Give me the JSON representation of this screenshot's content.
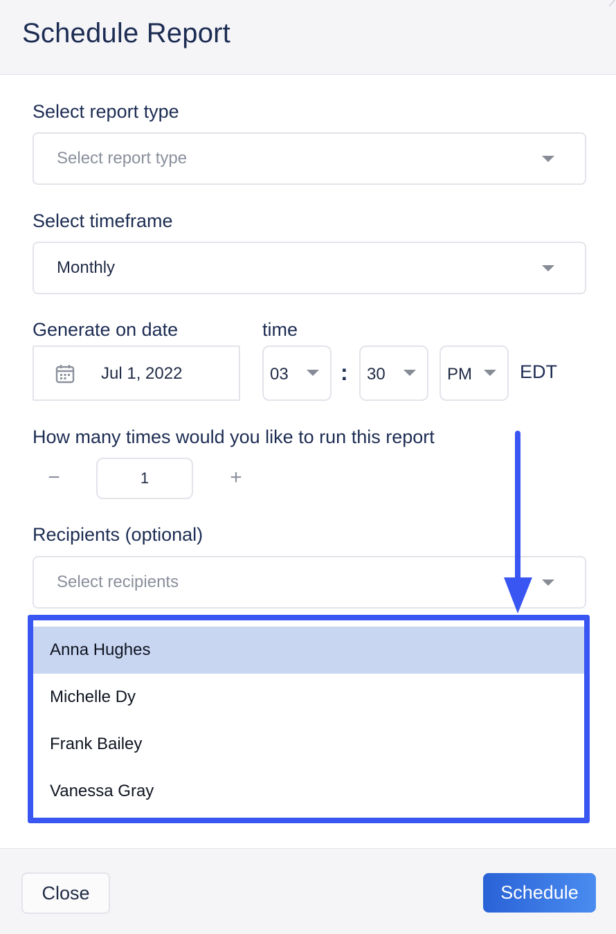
{
  "dialog": {
    "title": "Schedule Report"
  },
  "report_type": {
    "label": "Select report type",
    "placeholder": "Select report type"
  },
  "timeframe": {
    "label": "Select timeframe",
    "value": "Monthly"
  },
  "generate": {
    "date_label": "Generate on date",
    "date_value": "Jul 1, 2022",
    "time_label": "time",
    "hour": "03",
    "separator": ":",
    "minute": "30",
    "ampm": "PM",
    "timezone": "EDT"
  },
  "run_count": {
    "label": "How many times would you like to run this report",
    "minus": "−",
    "value": "1",
    "plus": "+"
  },
  "recipients": {
    "label": "Recipients (optional)",
    "placeholder": "Select recipients",
    "options": [
      "Anna Hughes",
      "Michelle Dy",
      "Frank Bailey",
      "Vanessa Gray"
    ]
  },
  "footer": {
    "close_label": "Close",
    "schedule_label": "Schedule"
  },
  "colors": {
    "annotation_blue": "#3a56f2",
    "highlight_row": "#c9d6f2",
    "primary_button": "#2962d6",
    "title_text": "#1c2c52"
  },
  "icons": {
    "calendar": "calendar-icon",
    "dropdown": "chevron-down-icon"
  }
}
